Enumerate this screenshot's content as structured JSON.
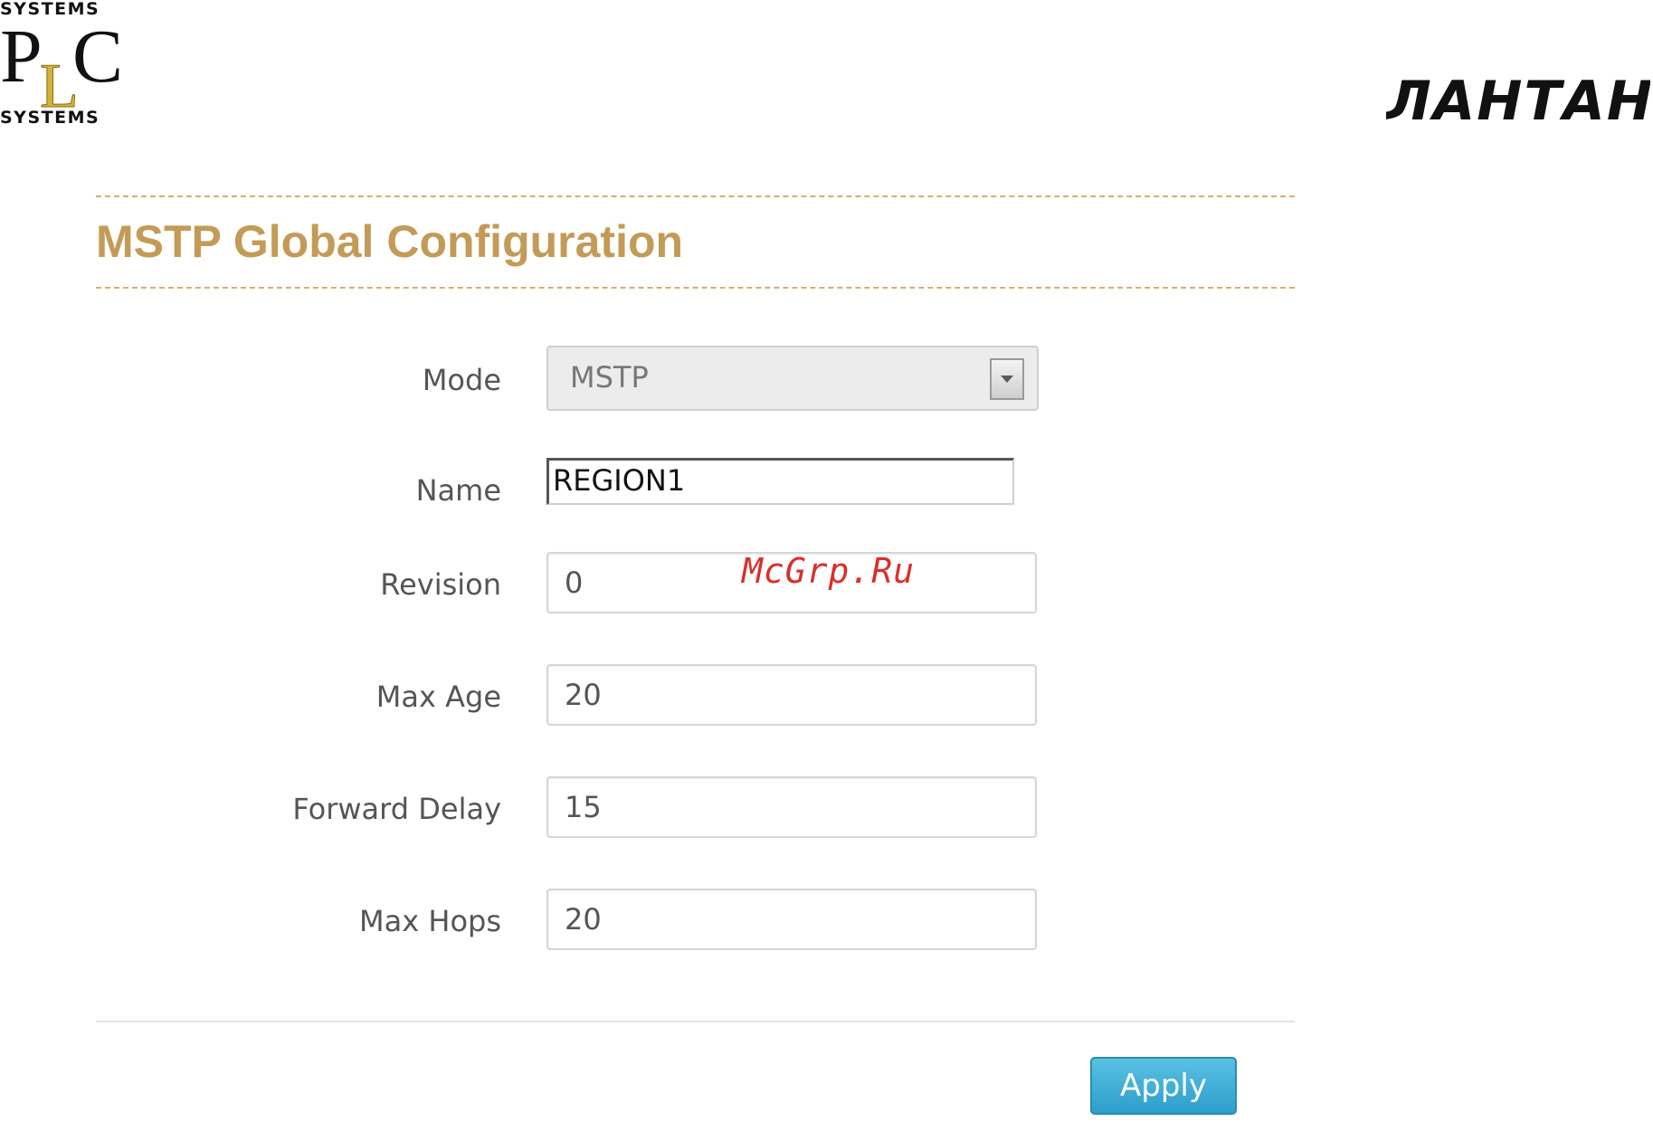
{
  "logos": {
    "left": {
      "top_text": "SYSTEMS",
      "letters": "PLC",
      "bottom_text": "SYSTEMS"
    },
    "right": {
      "text": "ЛАНТАН"
    }
  },
  "page": {
    "title": "MSTP Global Configuration"
  },
  "form": {
    "mode": {
      "label": "Mode",
      "value": "MSTP"
    },
    "name": {
      "label": "Name",
      "value": "REGION1"
    },
    "revision": {
      "label": "Revision",
      "value": "0"
    },
    "max_age": {
      "label": "Max Age",
      "value": "20"
    },
    "forward_delay": {
      "label": "Forward Delay",
      "value": "15"
    },
    "max_hops": {
      "label": "Max Hops",
      "value": "20"
    }
  },
  "watermark": "McGrp.Ru",
  "actions": {
    "apply_label": "Apply"
  },
  "colors": {
    "title": "#c49a57",
    "apply_button": "#2c9fcc",
    "watermark": "#d9302c"
  }
}
